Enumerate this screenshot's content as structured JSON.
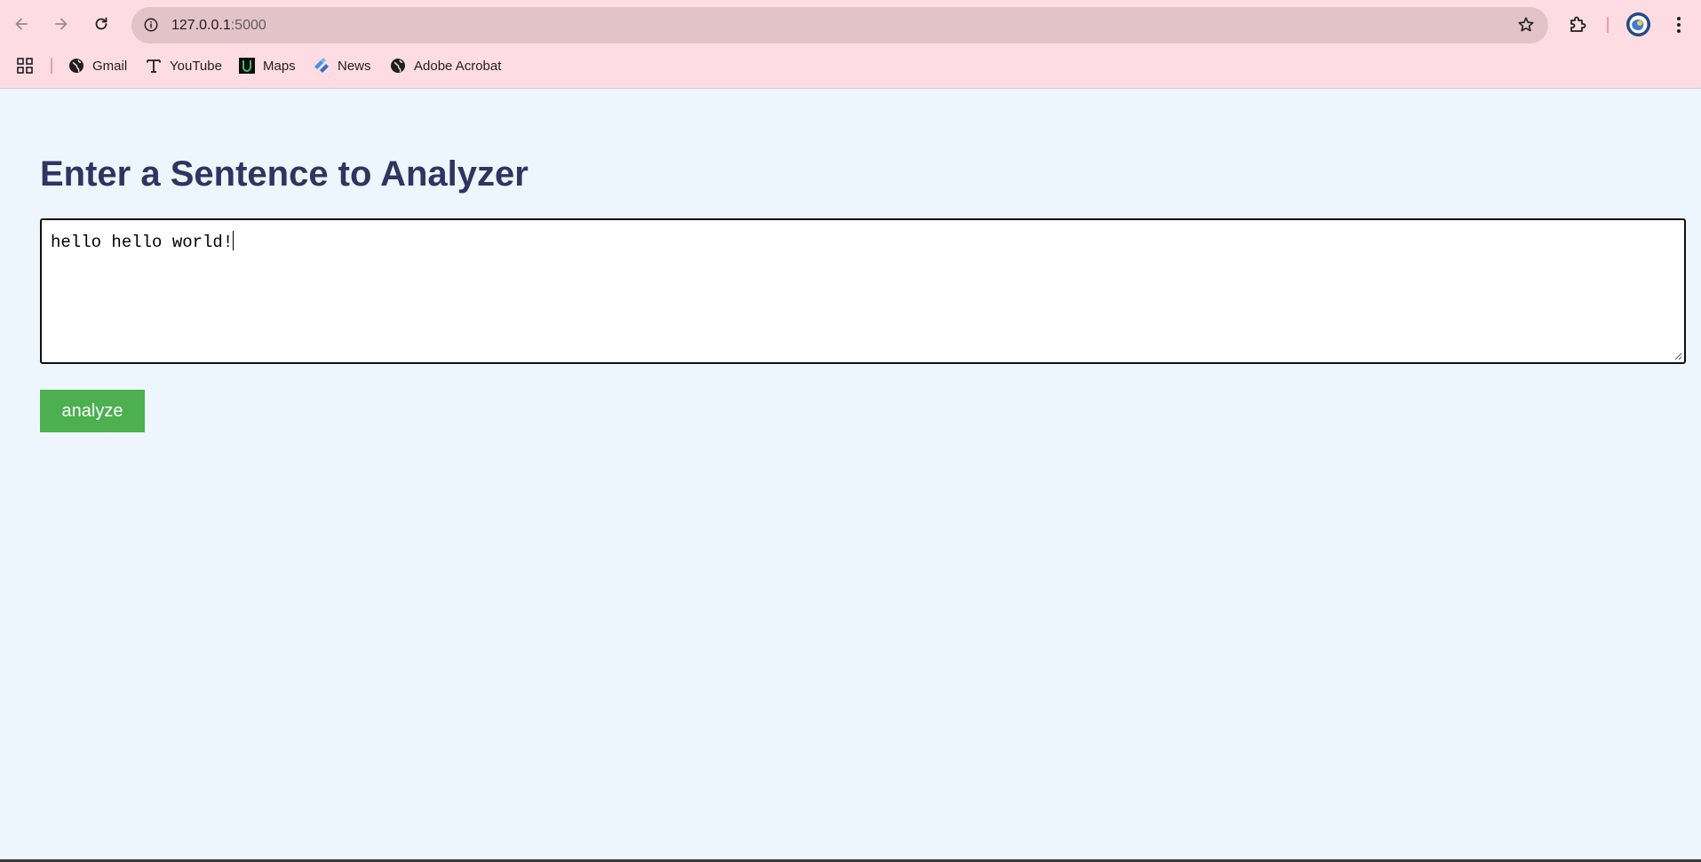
{
  "browser": {
    "url_host": "127.0.0.1",
    "url_port": ":5000",
    "accent_color": "#fddde3",
    "omnibox_color": "#e2c3c8",
    "icons": [
      "back-arrow-icon",
      "forward-arrow-icon",
      "reload-icon",
      "site-info-icon",
      "bookmark-star-icon",
      "extensions-icon",
      "profile-avatar-icon",
      "kebab-menu-icon"
    ]
  },
  "bookmarks": {
    "items": [
      {
        "label": "Gmail",
        "icon": "globe-icon"
      },
      {
        "label": "YouTube",
        "icon": "text-t-icon"
      },
      {
        "label": "Maps",
        "icon": "maps-icon"
      },
      {
        "label": "News",
        "icon": "news-diamond-icon"
      },
      {
        "label": "Adobe Acrobat",
        "icon": "globe-icon"
      }
    ]
  },
  "page": {
    "title": "Enter a Sentence to Analyzer",
    "title_color": "#2e3561",
    "background_color": "#eef6fd",
    "input_value": "hello hello world!",
    "button_label": "analyze",
    "button_color": "#4caf50"
  }
}
